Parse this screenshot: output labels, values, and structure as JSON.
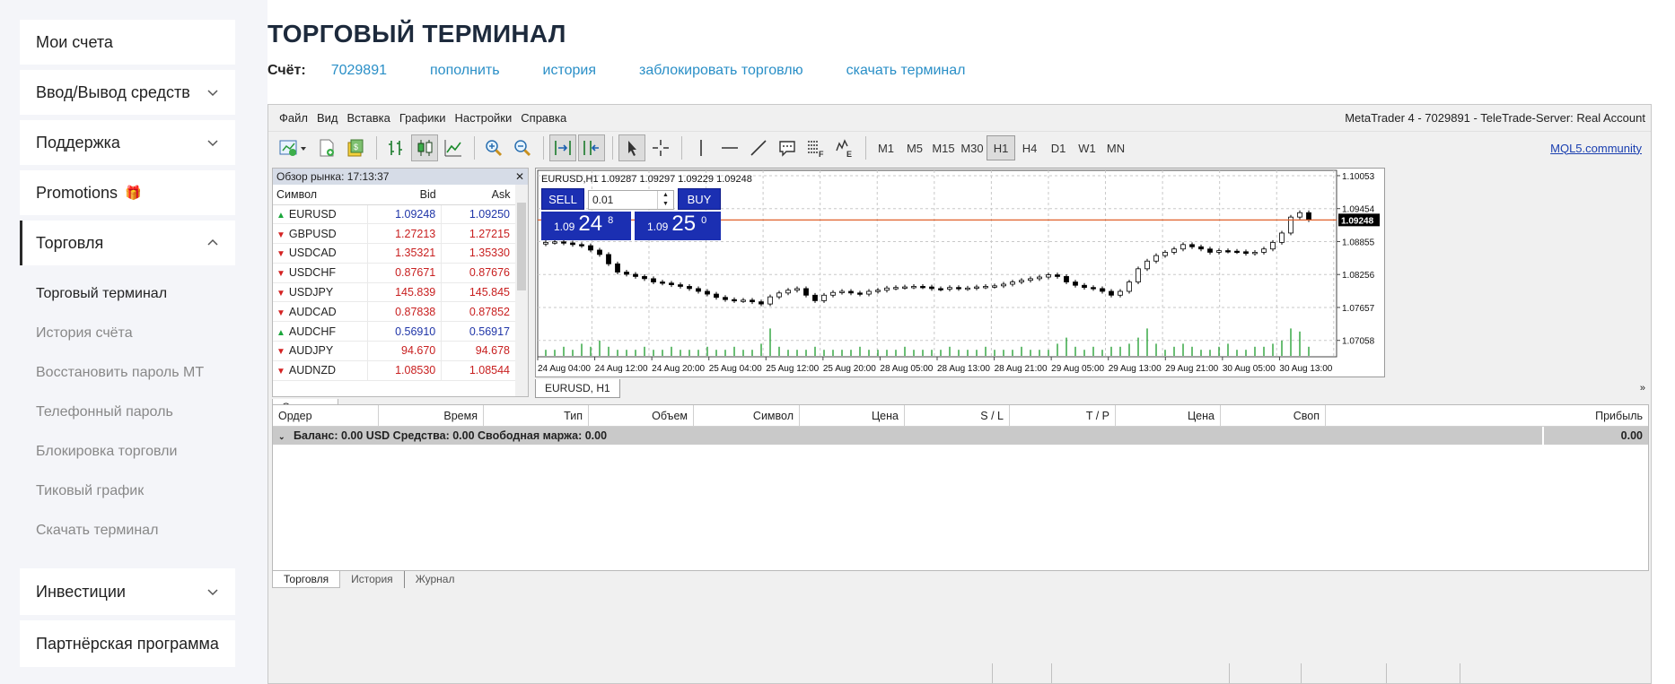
{
  "sidebar": {
    "items": [
      {
        "label": "Мои счета"
      },
      {
        "label": "Ввод/Вывод средств"
      },
      {
        "label": "Поддержка"
      },
      {
        "label": "Promotions"
      },
      {
        "label": "Торговля"
      },
      {
        "label": "Инвестиции"
      },
      {
        "label": "Партнёрская программа"
      }
    ],
    "submenu": [
      "Торговый терминал",
      "История счёта",
      "Восстановить пароль MT",
      "Телефонный пароль",
      "Блокировка торговли",
      "Тиковый график",
      "Скачать терминал"
    ]
  },
  "page": {
    "title": "ТОРГОВЫЙ ТЕРМИНАЛ",
    "account_label": "Счёт:",
    "account_number": "7029891",
    "links": [
      "пополнить",
      "история",
      "заблокировать торговлю",
      "скачать терминал"
    ]
  },
  "terminal": {
    "menu": [
      "Файл",
      "Вид",
      "Вставка",
      "Графики",
      "Настройки",
      "Справка"
    ],
    "window_title": "MetaTrader 4 - 7029891 - TeleTrade-Server: Real Account",
    "timeframes": [
      "M1",
      "M5",
      "M15",
      "M30",
      "H1",
      "H4",
      "D1",
      "W1",
      "MN"
    ],
    "active_timeframe": "H1",
    "mql_link": "MQL5.community",
    "market_watch": {
      "title": "Обзор рынка: 17:13:37",
      "columns": [
        "Символ",
        "Bid",
        "Ask"
      ],
      "rows": [
        {
          "symbol": "EURUSD",
          "dir": "up",
          "bid": "1.09248",
          "ask": "1.09250"
        },
        {
          "symbol": "GBPUSD",
          "dir": "down",
          "bid": "1.27213",
          "ask": "1.27215"
        },
        {
          "symbol": "USDCAD",
          "dir": "down",
          "bid": "1.35321",
          "ask": "1.35330"
        },
        {
          "symbol": "USDCHF",
          "dir": "down",
          "bid": "0.87671",
          "ask": "0.87676"
        },
        {
          "symbol": "USDJPY",
          "dir": "down",
          "bid": "145.839",
          "ask": "145.845"
        },
        {
          "symbol": "AUDCAD",
          "dir": "down",
          "bid": "0.87838",
          "ask": "0.87852"
        },
        {
          "symbol": "AUDCHF",
          "dir": "up",
          "bid": "0.56910",
          "ask": "0.56917"
        },
        {
          "symbol": "AUDJPY",
          "dir": "down",
          "bid": "94.670",
          "ask": "94.678"
        },
        {
          "symbol": "AUDNZD",
          "dir": "down",
          "bid": "1.08530",
          "ask": "1.08544"
        }
      ],
      "tab": "Символы"
    },
    "chart": {
      "info": "EURUSD,H1  1.09287 1.09297 1.09229 1.09248",
      "sell_label": "SELL",
      "buy_label": "BUY",
      "lot": "0.01",
      "sell_price_prefix": "1.09",
      "sell_price_big": "24",
      "sell_price_sup": "8",
      "buy_price_prefix": "1.09",
      "buy_price_big": "25",
      "buy_price_sup": "0",
      "price_labels": [
        "1.10053",
        "1.09454",
        "1.08855",
        "1.08256",
        "1.07657",
        "1.07058"
      ],
      "current_price": "1.09248",
      "time_labels": [
        "24 Aug 04:00",
        "24 Aug 12:00",
        "24 Aug 20:00",
        "25 Aug 04:00",
        "25 Aug 12:00",
        "25 Aug 20:00",
        "28 Aug 05:00",
        "28 Aug 13:00",
        "28 Aug 21:00",
        "29 Aug 05:00",
        "29 Aug 13:00",
        "29 Aug 21:00",
        "30 Aug 05:00",
        "30 Aug 13:00"
      ],
      "tab": "EURUSD, H1",
      "accent_line": "#e0602a"
    },
    "orders": {
      "columns": [
        "Ордер",
        "Время",
        "Тип",
        "Объем",
        "Символ",
        "Цена",
        "S / L",
        "T / P",
        "Цена",
        "Своп",
        "Прибыль"
      ],
      "balance_text": "Баланс: 0.00 USD  Средства: 0.00  Свободная маржа: 0.00",
      "profit": "0.00",
      "tabs": [
        "Торговля",
        "История",
        "Журнал"
      ]
    }
  },
  "chart_data": {
    "type": "candlestick",
    "title": "EURUSD,H1",
    "ylim": [
      1.0676,
      1.1015
    ],
    "closes": [
      1.0884,
      1.0885,
      1.0883,
      1.088,
      1.0878,
      1.087,
      1.0862,
      1.0845,
      1.083,
      1.0826,
      1.0822,
      1.0818,
      1.0812,
      1.081,
      1.0807,
      1.0804,
      1.08,
      1.0795,
      1.079,
      1.0784,
      1.078,
      1.0778,
      1.0779,
      1.0776,
      1.0772,
      1.0785,
      1.0792,
      1.0797,
      1.08,
      1.0788,
      1.0778,
      1.0788,
      1.0793,
      1.0795,
      1.0792,
      1.079,
      1.0795,
      1.0797,
      1.0801,
      1.0802,
      1.0803,
      1.0804,
      1.0803,
      1.08,
      1.0799,
      1.0802,
      1.08,
      1.0801,
      1.0803,
      1.0804,
      1.0805,
      1.0808,
      1.0812,
      1.0815,
      1.0818,
      1.0821,
      1.0825,
      1.0822,
      1.0812,
      1.0806,
      1.0802,
      1.08,
      1.0795,
      1.0788,
      1.0795,
      1.0812,
      1.0836,
      1.085,
      1.086,
      1.0866,
      1.0872,
      1.088,
      1.0876,
      1.0872,
      1.0866,
      1.0869,
      1.0868,
      1.0867,
      1.0864,
      1.0866,
      1.0872,
      1.0884,
      1.0901,
      1.093,
      1.0938,
      1.0925
    ],
    "volumes": [
      2,
      2,
      3,
      2,
      4,
      3,
      5,
      3,
      2,
      2,
      2,
      3,
      2,
      2,
      3,
      2,
      2,
      2,
      3,
      2,
      2,
      3,
      2,
      2,
      4,
      9,
      3,
      2,
      2,
      2,
      3,
      2,
      2,
      2,
      2,
      3,
      2,
      2,
      2,
      2,
      3,
      2,
      2,
      2,
      2,
      3,
      2,
      2,
      2,
      3,
      2,
      2,
      2,
      3,
      2,
      2,
      2,
      4,
      6,
      3,
      2,
      3,
      2,
      3,
      3,
      4,
      6,
      9,
      4,
      2,
      3,
      4,
      3,
      2,
      2,
      3,
      4,
      2,
      2,
      3,
      3,
      4,
      5,
      9,
      8,
      3
    ]
  }
}
